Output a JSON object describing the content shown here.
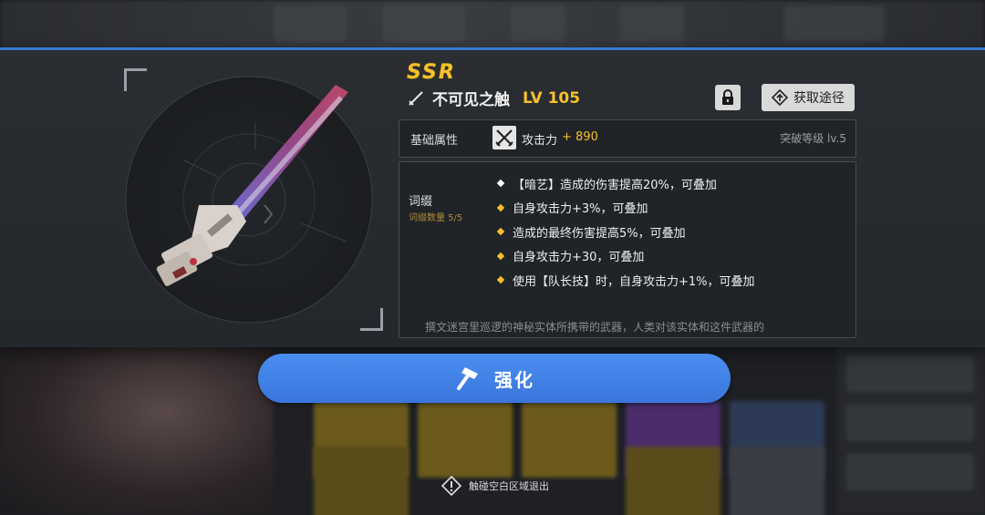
{
  "weapon": {
    "rarity": "SSR",
    "name": "不可见之触",
    "level": "LV 105",
    "icon": "sword-icon"
  },
  "actions": {
    "lock_icon": "lock-icon",
    "source_label": "获取途径",
    "source_icon": "diamond-arrow-icon"
  },
  "stats": {
    "section_label": "基础属性",
    "attack_icon": "crossed-swords-icon",
    "attack_label": "攻击力",
    "attack_value": "+ 890",
    "breakthrough": "突破等级 lv.5"
  },
  "affixes": {
    "title": "词缀",
    "count": "词缀数量 5/5",
    "items": [
      {
        "text": "【暗艺】造成的伤害提高20%，可叠加",
        "color": "#ffffff"
      },
      {
        "text": "自身攻击力+3%，可叠加",
        "color": "#f5c12b"
      },
      {
        "text": "造成的最终伤害提高5%，可叠加",
        "color": "#f5c12b"
      },
      {
        "text": "自身攻击力+30，可叠加",
        "color": "#f5c12b"
      },
      {
        "text": "使用【队长技】时，自身攻击力+1%，可叠加",
        "color": "#f5c12b"
      }
    ],
    "lore": "撰文迷宫里巡逻的神秘实体所携带的武器，人类对该实体和这件武器的"
  },
  "enhance": {
    "label": "强化",
    "icon": "hammer-icon"
  },
  "hint": {
    "text": "触碰空白区域退出",
    "icon": "warning-icon"
  },
  "colors": {
    "accent_blue": "#3b78d8",
    "gold": "#f5c12b",
    "button_blue": "#4a8ef0"
  }
}
